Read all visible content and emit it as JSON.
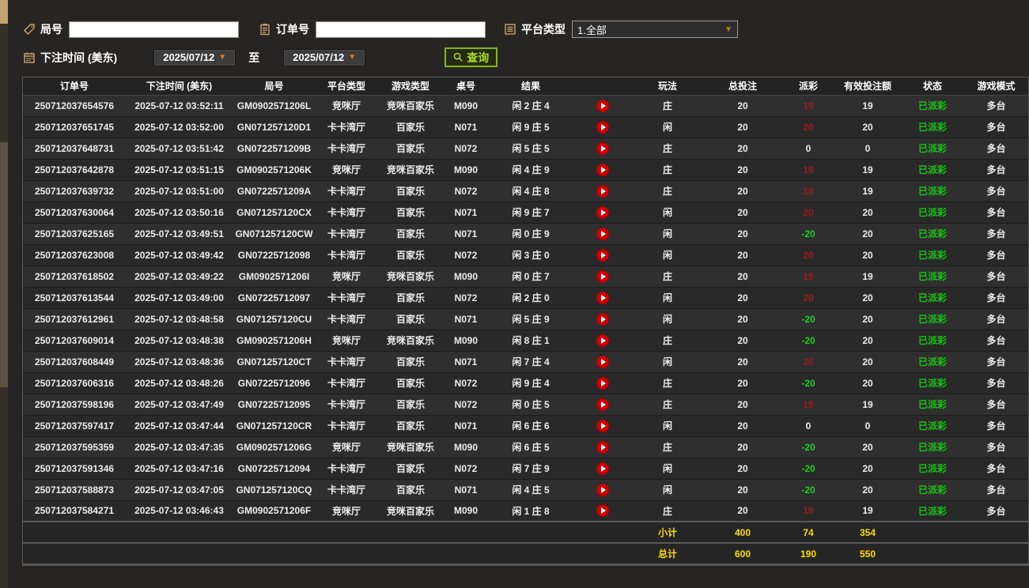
{
  "filters": {
    "round_label": "局号",
    "round_value": "",
    "order_label": "订单号",
    "order_value": "",
    "platform_label": "平台类型",
    "platform_value": "1.全部",
    "bet_time_label": "下注时间 (美东)",
    "date_from": "2025/07/12",
    "to_label": "至",
    "date_to": "2025/07/12",
    "query_label": "查询"
  },
  "icons": {
    "dropdown_arrow": "▼"
  },
  "colors": {
    "payout_positive": "#9b1c1c",
    "payout_negative": "#1ecf1e",
    "status_paid": "#18c418",
    "summary_yellow": "#ffdf00",
    "query_green": "#aadd2c",
    "icon_tan": "#c9a469",
    "arrow_orange": "#e07b1f",
    "play_red": "#d40000"
  },
  "table": {
    "headers": [
      "订单号",
      "下注时间 (美东)",
      "局号",
      "平台类型",
      "游戏类型",
      "桌号",
      "结果",
      "",
      "玩法",
      "总投注",
      "派彩",
      "有效投注额",
      "状态",
      "游戏模式"
    ],
    "rows": [
      {
        "order_id": "250712037654576",
        "bet_time": "2025-07-12 03:52:11",
        "round_id": "GM0902571206L",
        "platform": "竞咪厅",
        "game_type": "竞咪百家乐",
        "table_no": "M090",
        "result": "闲 2 庄 4",
        "play": "庄",
        "total_bet": "20",
        "payout": "19",
        "payout_class": "pos",
        "valid_bet": "19",
        "status": "已派彩",
        "mode": "多台"
      },
      {
        "order_id": "250712037651745",
        "bet_time": "2025-07-12 03:52:00",
        "round_id": "GN071257120D1",
        "platform": "卡卡湾厅",
        "game_type": "百家乐",
        "table_no": "N071",
        "result": "闲 9 庄 5",
        "play": "闲",
        "total_bet": "20",
        "payout": "20",
        "payout_class": "pos",
        "valid_bet": "20",
        "status": "已派彩",
        "mode": "多台"
      },
      {
        "order_id": "250712037648731",
        "bet_time": "2025-07-12 03:51:42",
        "round_id": "GN0722571209B",
        "platform": "卡卡湾厅",
        "game_type": "百家乐",
        "table_no": "N072",
        "result": "闲 5 庄 5",
        "play": "庄",
        "total_bet": "20",
        "payout": "0",
        "payout_class": "zero",
        "valid_bet": "0",
        "status": "已派彩",
        "mode": "多台"
      },
      {
        "order_id": "250712037642878",
        "bet_time": "2025-07-12 03:51:15",
        "round_id": "GM0902571206K",
        "platform": "竞咪厅",
        "game_type": "竞咪百家乐",
        "table_no": "M090",
        "result": "闲 4 庄 9",
        "play": "庄",
        "total_bet": "20",
        "payout": "19",
        "payout_class": "pos",
        "valid_bet": "19",
        "status": "已派彩",
        "mode": "多台"
      },
      {
        "order_id": "250712037639732",
        "bet_time": "2025-07-12 03:51:00",
        "round_id": "GN0722571209A",
        "platform": "卡卡湾厅",
        "game_type": "百家乐",
        "table_no": "N072",
        "result": "闲 4 庄 8",
        "play": "庄",
        "total_bet": "20",
        "payout": "19",
        "payout_class": "pos",
        "valid_bet": "19",
        "status": "已派彩",
        "mode": "多台"
      },
      {
        "order_id": "250712037630064",
        "bet_time": "2025-07-12 03:50:16",
        "round_id": "GN071257120CX",
        "platform": "卡卡湾厅",
        "game_type": "百家乐",
        "table_no": "N071",
        "result": "闲 9 庄 7",
        "play": "闲",
        "total_bet": "20",
        "payout": "20",
        "payout_class": "pos",
        "valid_bet": "20",
        "status": "已派彩",
        "mode": "多台"
      },
      {
        "order_id": "250712037625165",
        "bet_time": "2025-07-12 03:49:51",
        "round_id": "GN071257120CW",
        "platform": "卡卡湾厅",
        "game_type": "百家乐",
        "table_no": "N071",
        "result": "闲 0 庄 9",
        "play": "闲",
        "total_bet": "20",
        "payout": "-20",
        "payout_class": "neg",
        "valid_bet": "20",
        "status": "已派彩",
        "mode": "多台"
      },
      {
        "order_id": "250712037623008",
        "bet_time": "2025-07-12 03:49:42",
        "round_id": "GN07225712098",
        "platform": "卡卡湾厅",
        "game_type": "百家乐",
        "table_no": "N072",
        "result": "闲 3 庄 0",
        "play": "闲",
        "total_bet": "20",
        "payout": "20",
        "payout_class": "pos",
        "valid_bet": "20",
        "status": "已派彩",
        "mode": "多台"
      },
      {
        "order_id": "250712037618502",
        "bet_time": "2025-07-12 03:49:22",
        "round_id": "GM0902571206I",
        "platform": "竞咪厅",
        "game_type": "竞咪百家乐",
        "table_no": "M090",
        "result": "闲 0 庄 7",
        "play": "庄",
        "total_bet": "20",
        "payout": "19",
        "payout_class": "pos",
        "valid_bet": "19",
        "status": "已派彩",
        "mode": "多台"
      },
      {
        "order_id": "250712037613544",
        "bet_time": "2025-07-12 03:49:00",
        "round_id": "GN07225712097",
        "platform": "卡卡湾厅",
        "game_type": "百家乐",
        "table_no": "N072",
        "result": "闲 2 庄 0",
        "play": "闲",
        "total_bet": "20",
        "payout": "20",
        "payout_class": "pos",
        "valid_bet": "20",
        "status": "已派彩",
        "mode": "多台"
      },
      {
        "order_id": "250712037612961",
        "bet_time": "2025-07-12 03:48:58",
        "round_id": "GN071257120CU",
        "platform": "卡卡湾厅",
        "game_type": "百家乐",
        "table_no": "N071",
        "result": "闲 5 庄 9",
        "play": "闲",
        "total_bet": "20",
        "payout": "-20",
        "payout_class": "neg",
        "valid_bet": "20",
        "status": "已派彩",
        "mode": "多台"
      },
      {
        "order_id": "250712037609014",
        "bet_time": "2025-07-12 03:48:38",
        "round_id": "GM0902571206H",
        "platform": "竞咪厅",
        "game_type": "竞咪百家乐",
        "table_no": "M090",
        "result": "闲 8 庄 1",
        "play": "庄",
        "total_bet": "20",
        "payout": "-20",
        "payout_class": "neg",
        "valid_bet": "20",
        "status": "已派彩",
        "mode": "多台"
      },
      {
        "order_id": "250712037608449",
        "bet_time": "2025-07-12 03:48:36",
        "round_id": "GN071257120CT",
        "platform": "卡卡湾厅",
        "game_type": "百家乐",
        "table_no": "N071",
        "result": "闲 7 庄 4",
        "play": "闲",
        "total_bet": "20",
        "payout": "20",
        "payout_class": "pos",
        "valid_bet": "20",
        "status": "已派彩",
        "mode": "多台"
      },
      {
        "order_id": "250712037606316",
        "bet_time": "2025-07-12 03:48:26",
        "round_id": "GN07225712096",
        "platform": "卡卡湾厅",
        "game_type": "百家乐",
        "table_no": "N072",
        "result": "闲 9 庄 4",
        "play": "庄",
        "total_bet": "20",
        "payout": "-20",
        "payout_class": "neg",
        "valid_bet": "20",
        "status": "已派彩",
        "mode": "多台"
      },
      {
        "order_id": "250712037598196",
        "bet_time": "2025-07-12 03:47:49",
        "round_id": "GN07225712095",
        "platform": "卡卡湾厅",
        "game_type": "百家乐",
        "table_no": "N072",
        "result": "闲 0 庄 5",
        "play": "庄",
        "total_bet": "20",
        "payout": "19",
        "payout_class": "pos",
        "valid_bet": "19",
        "status": "已派彩",
        "mode": "多台"
      },
      {
        "order_id": "250712037597417",
        "bet_time": "2025-07-12 03:47:44",
        "round_id": "GN071257120CR",
        "platform": "卡卡湾厅",
        "game_type": "百家乐",
        "table_no": "N071",
        "result": "闲 6 庄 6",
        "play": "闲",
        "total_bet": "20",
        "payout": "0",
        "payout_class": "zero",
        "valid_bet": "0",
        "status": "已派彩",
        "mode": "多台"
      },
      {
        "order_id": "250712037595359",
        "bet_time": "2025-07-12 03:47:35",
        "round_id": "GM0902571206G",
        "platform": "竞咪厅",
        "game_type": "竞咪百家乐",
        "table_no": "M090",
        "result": "闲 6 庄 5",
        "play": "庄",
        "total_bet": "20",
        "payout": "-20",
        "payout_class": "neg",
        "valid_bet": "20",
        "status": "已派彩",
        "mode": "多台"
      },
      {
        "order_id": "250712037591346",
        "bet_time": "2025-07-12 03:47:16",
        "round_id": "GN07225712094",
        "platform": "卡卡湾厅",
        "game_type": "百家乐",
        "table_no": "N072",
        "result": "闲 7 庄 9",
        "play": "闲",
        "total_bet": "20",
        "payout": "-20",
        "payout_class": "neg",
        "valid_bet": "20",
        "status": "已派彩",
        "mode": "多台"
      },
      {
        "order_id": "250712037588873",
        "bet_time": "2025-07-12 03:47:05",
        "round_id": "GN071257120CQ",
        "platform": "卡卡湾厅",
        "game_type": "百家乐",
        "table_no": "N071",
        "result": "闲 4 庄 5",
        "play": "闲",
        "total_bet": "20",
        "payout": "-20",
        "payout_class": "neg",
        "valid_bet": "20",
        "status": "已派彩",
        "mode": "多台"
      },
      {
        "order_id": "250712037584271",
        "bet_time": "2025-07-12 03:46:43",
        "round_id": "GM0902571206F",
        "platform": "竞咪厅",
        "game_type": "竞咪百家乐",
        "table_no": "M090",
        "result": "闲 1 庄 8",
        "play": "庄",
        "total_bet": "20",
        "payout": "19",
        "payout_class": "pos",
        "valid_bet": "19",
        "status": "已派彩",
        "mode": "多台"
      }
    ],
    "subtotal": {
      "label": "小计",
      "total_bet": "400",
      "payout": "74",
      "valid_bet": "354"
    },
    "total": {
      "label": "总计",
      "total_bet": "600",
      "payout": "190",
      "valid_bet": "550"
    }
  }
}
